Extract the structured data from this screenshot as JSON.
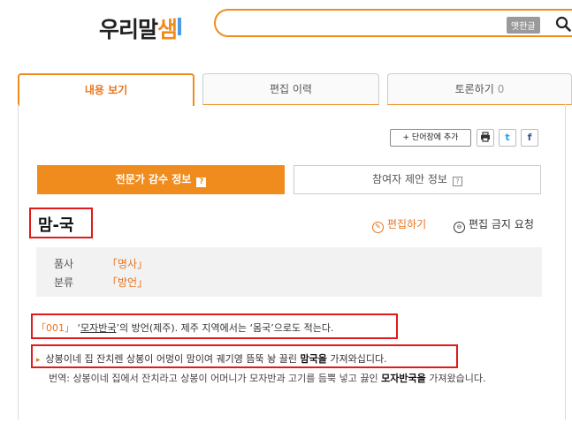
{
  "header": {
    "logo_main": "우리말",
    "logo_accent": "샘",
    "search_placeholder": "",
    "old_hangul_label": "옛한글"
  },
  "tabs": [
    {
      "label": "내용 보기",
      "active": true
    },
    {
      "label": "편집 이력",
      "active": false
    },
    {
      "label": "토론하기",
      "count": "0",
      "active": false
    }
  ],
  "tools": {
    "add_word_label": "+ 단어장에 추가",
    "print_icon": "print-icon",
    "twitter_label": "t",
    "facebook_label": "f"
  },
  "subtabs": {
    "expert_label": "전문가 감수 정보",
    "expert_q": "?",
    "user_label": "참여자 제안 정보",
    "user_q": "?"
  },
  "entry": {
    "headword": "맘-국",
    "edit_label": "편집하기",
    "edit_ban_label": "편집 금지 요청",
    "pos_label": "품사",
    "pos_value": "「명사」",
    "category_label": "분류",
    "category_value": "「방언」"
  },
  "definition": {
    "number": "「001」",
    "pre_quote": "‘",
    "linked_word": "모자반국",
    "post_text": "’의 방언(제주). 제주 지역에서는 ‘몸국’으로도 적는다."
  },
  "example": {
    "text_before": "상봉이네 집 잔치렌 상봉이 어멍이 맘이여 궤기영 뜸뚝 놩 끌린 ",
    "bold": "맘국을",
    "text_after": " 가져와십디다."
  },
  "translation": {
    "text_before": "번역: 상봉이네 집에서 잔치라고 상봉이 어머니가 모자반과 고기를 듬뿍 넣고 끓인 ",
    "bold": "모자반국을",
    "text_after": " 가져왔습니다."
  }
}
